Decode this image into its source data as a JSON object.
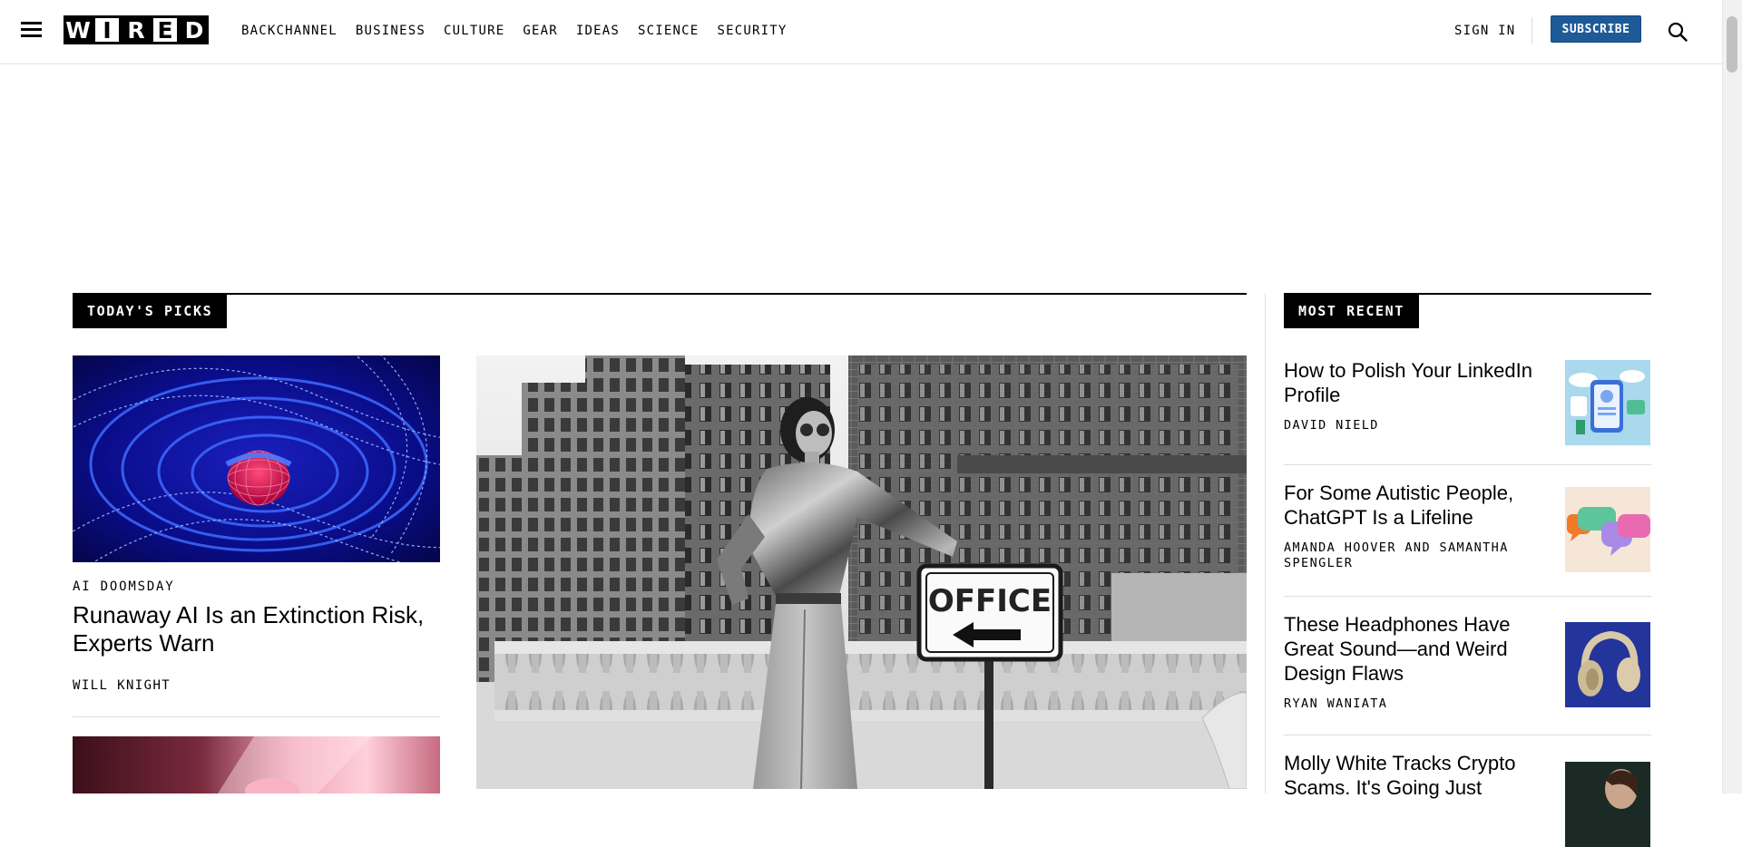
{
  "header": {
    "logo_letters": [
      "W",
      "I",
      "R",
      "E",
      "D"
    ],
    "nav": [
      "BACKCHANNEL",
      "BUSINESS",
      "CULTURE",
      "GEAR",
      "IDEAS",
      "SCIENCE",
      "SECURITY"
    ],
    "sign_in": "SIGN IN",
    "subscribe": "SUBSCRIBE"
  },
  "todays_picks": {
    "label": "TODAY'S PICKS",
    "story1": {
      "rubric": "AI DOOMSDAY",
      "title": "Runaway AI Is an Extinction Risk, Experts Warn",
      "byline": "WILL KNIGHT"
    },
    "hero_sign_text": "OFFICE"
  },
  "most_recent": {
    "label": "MOST RECENT",
    "items": [
      {
        "title": "How to Polish Your LinkedIn Profile",
        "byline": "DAVID NIELD"
      },
      {
        "title": "For Some Autistic People, ChatGPT Is a Lifeline",
        "byline": "AMANDA HOOVER AND SAMANTHA SPENGLER"
      },
      {
        "title": "These Headphones Have Great Sound—and Weird Design Flaws",
        "byline": "RYAN WANIATA"
      },
      {
        "title": "Molly White Tracks Crypto Scams. It's Going Just",
        "byline": ""
      }
    ]
  },
  "colors": {
    "subscribe_bg": "#1e5a97"
  }
}
